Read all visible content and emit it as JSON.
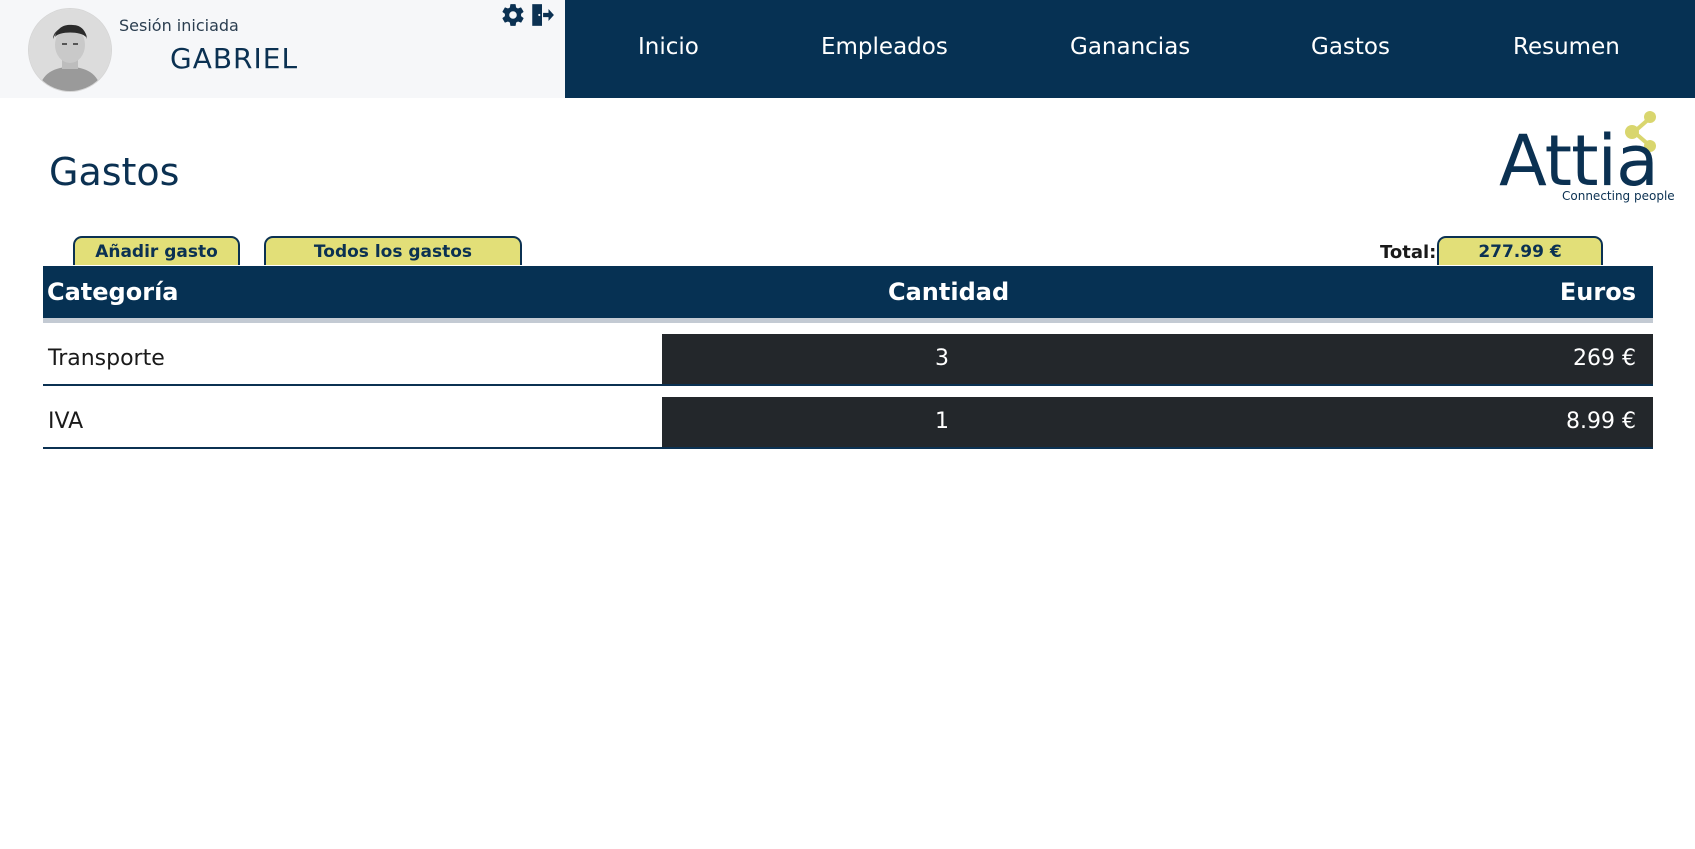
{
  "session": {
    "label": "Sesión iniciada",
    "user_name": "GABRIEL",
    "icons": [
      "gear-icon",
      "logout-icon"
    ]
  },
  "nav": {
    "items": [
      {
        "label": "Inicio"
      },
      {
        "label": "Empleados"
      },
      {
        "label": "Ganancias"
      },
      {
        "label": "Gastos"
      },
      {
        "label": "Resumen"
      }
    ]
  },
  "page": {
    "title": "Gastos"
  },
  "logo": {
    "name": "Attia",
    "tagline": "Connecting people"
  },
  "tabs": [
    {
      "label": "Añadir gasto"
    },
    {
      "label": "Todos los gastos"
    }
  ],
  "total": {
    "label": "Total:",
    "value": "277.99 €"
  },
  "table": {
    "headers": {
      "category": "Categoría",
      "quantity": "Cantidad",
      "euros": "Euros"
    },
    "rows": [
      {
        "category": "Transporte",
        "quantity": "3",
        "euros": "269 €"
      },
      {
        "category": "IVA",
        "quantity": "1",
        "euros": "8.99 €"
      }
    ]
  },
  "colors": {
    "navy": "#063153",
    "accent_yellow": "#e2df78",
    "dark_cell": "#23272b",
    "panel_bg": "#f6f7f9"
  }
}
